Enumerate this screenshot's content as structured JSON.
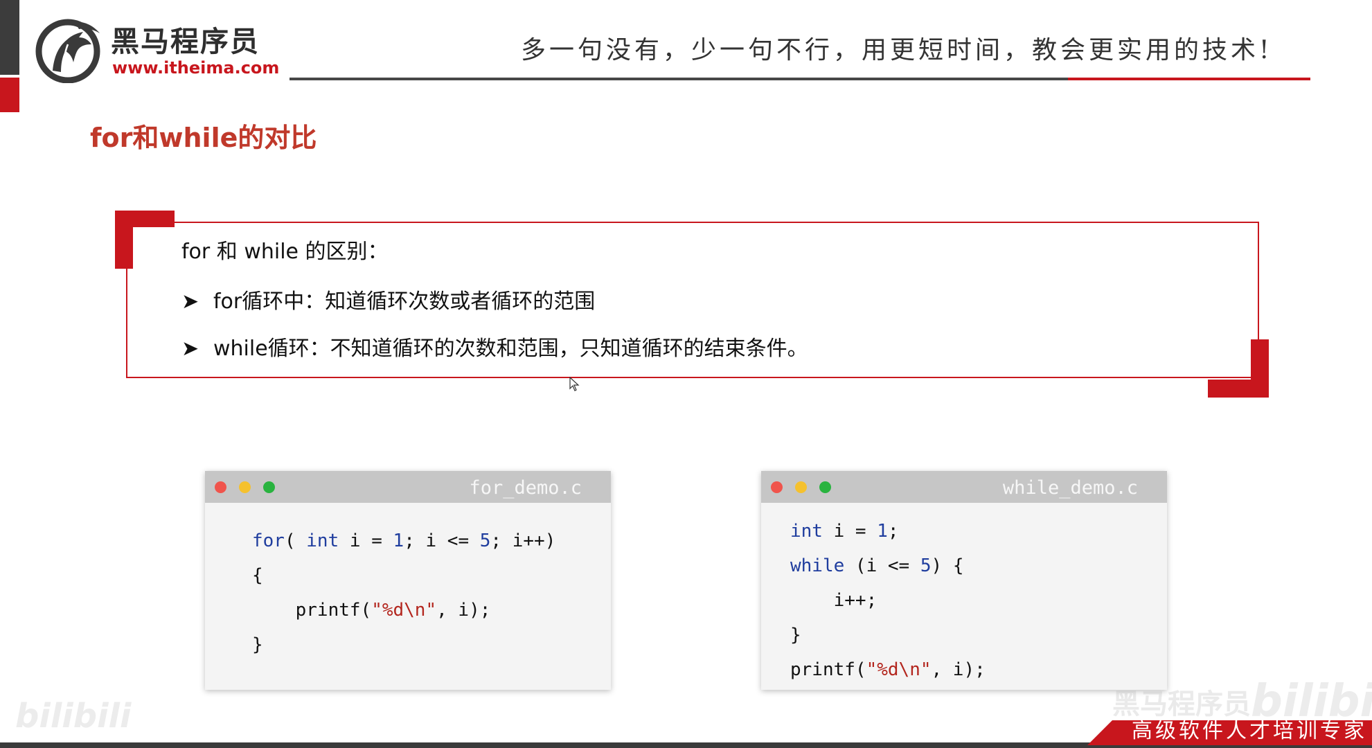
{
  "header": {
    "logo_cn": "黑马程序员",
    "logo_url": "www.itheima.com",
    "slogan": "多一句没有，少一句不行，用更短时间，教会更实用的技术!"
  },
  "title": "for和while的对比",
  "comparison": {
    "heading": "for 和 while 的区别：",
    "bullet_glyph": "➤",
    "bullets": [
      "for循环中：知道循环次数或者循环的范围",
      "while循环：不知道循环的次数和范围，只知道循环的结束条件。"
    ]
  },
  "code_windows": {
    "for": {
      "filename": "for_demo.c",
      "tokens": {
        "kw_for": "for",
        "p1": "( ",
        "kw_int": "int",
        "p2": " i = ",
        "n1": "1",
        "p3": "; i <= ",
        "n5": "5",
        "p4": "; i++)",
        "l2": "{",
        "printf": "    printf(",
        "fmt": "\"%d\\n\"",
        "args": ", i);",
        "l4": "}"
      }
    },
    "while": {
      "filename": "while_demo.c",
      "tokens": {
        "kw_int": "int",
        "p1": " i = ",
        "n1": "1",
        "p2": ";",
        "kw_while": "while",
        "p3": " (i <= ",
        "n5": "5",
        "p4": ") {",
        "l3": "    i++;",
        "l4": "}",
        "printf": "printf(",
        "fmt": "\"%d\\n\"",
        "args": ", i);"
      }
    }
  },
  "watermarks": {
    "left": "bilibili",
    "right_a": "黑马程序员",
    "right_b": "bilibili"
  },
  "footer": {
    "tagline": "高级软件人才培训专家"
  },
  "colors": {
    "brand_red": "#c8161d",
    "title_red": "#c0392b",
    "keyword_blue": "#1f3d9e",
    "string_red": "#b3261e"
  }
}
